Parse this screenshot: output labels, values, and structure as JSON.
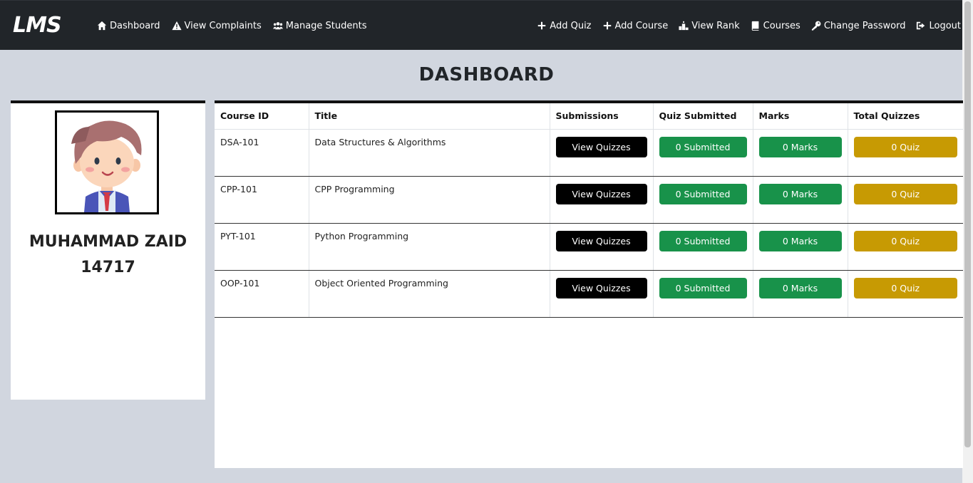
{
  "brand": {
    "logo_text": "LMS"
  },
  "nav": {
    "left": [
      {
        "label": "Dashboard",
        "icon": "home-icon"
      },
      {
        "label": "View Complaints",
        "icon": "warning-icon"
      },
      {
        "label": "Manage Students",
        "icon": "users-icon"
      }
    ],
    "right": [
      {
        "label": "Add Quiz",
        "icon": "plus-icon"
      },
      {
        "label": "Add Course",
        "icon": "plus-icon"
      },
      {
        "label": "View Rank",
        "icon": "podium-icon"
      },
      {
        "label": "Courses",
        "icon": "book-icon"
      },
      {
        "label": "Change Password",
        "icon": "key-icon"
      },
      {
        "label": "Logout",
        "icon": "logout-icon"
      }
    ]
  },
  "page": {
    "title": "DASHBOARD"
  },
  "profile": {
    "name": "MUHAMMAD ZAID",
    "id": "14717"
  },
  "table": {
    "headers": [
      "Course ID",
      "Title",
      "Submissions",
      "Quiz Submitted",
      "Marks",
      "Total Quizzes"
    ],
    "rows": [
      {
        "course_id": "DSA-101",
        "title": "Data Structures & Algorithms",
        "submissions": "View Quizzes",
        "quiz_submitted": "0 Submitted",
        "marks": "0 Marks",
        "total_quizzes": "0 Quiz"
      },
      {
        "course_id": "CPP-101",
        "title": "CPP Programming",
        "submissions": "View Quizzes",
        "quiz_submitted": "0 Submitted",
        "marks": "0 Marks",
        "total_quizzes": "0 Quiz"
      },
      {
        "course_id": "PYT-101",
        "title": "Python Programming",
        "submissions": "View Quizzes",
        "quiz_submitted": "0 Submitted",
        "marks": "0 Marks",
        "total_quizzes": "0 Quiz"
      },
      {
        "course_id": "OOP-101",
        "title": "Object Oriented Programming",
        "submissions": "View Quizzes",
        "quiz_submitted": "0 Submitted",
        "marks": "0 Marks",
        "total_quizzes": "0 Quiz"
      }
    ]
  },
  "colors": {
    "navbar": "#212529",
    "page_bg": "#d1d6df",
    "green": "#18924a",
    "gold": "#c79a03",
    "dark": "#000000"
  }
}
